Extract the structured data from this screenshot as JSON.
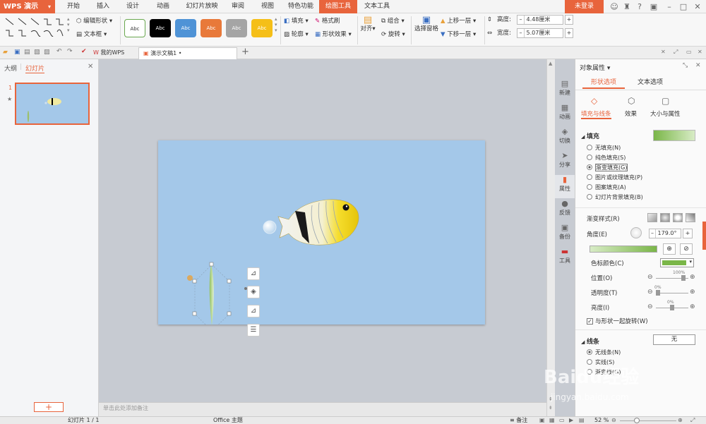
{
  "app": {
    "logo": "WPS 演示"
  },
  "menu": [
    "开始",
    "插入",
    "设计",
    "动画",
    "幻灯片放映",
    "审阅",
    "视图",
    "特色功能",
    "绘图工具",
    "文本工具"
  ],
  "login_label": "未登录",
  "ribbon": {
    "edit_shape": "编辑形状",
    "text_box": "文本框",
    "style_labels": [
      "Abc",
      "Abc",
      "Abc",
      "Abc",
      "Abc",
      "Abc"
    ],
    "fill": "填充",
    "format_brush": "格式刷",
    "outline": "轮廓",
    "shape_effect": "形状效果",
    "align": "对齐",
    "group": "组合",
    "rotate": "旋转",
    "selection_pane": "选择窗格",
    "bring_forward": "上移一层",
    "send_backward": "下移一层",
    "height_label": "高度:",
    "height_value": "4.48厘米",
    "width_label": "宽度:",
    "width_value": "5.07厘米"
  },
  "tabs": {
    "my_wps": "我的WPS",
    "doc": "演示文稿1 •"
  },
  "left_panel": {
    "outline_tab": "大纲",
    "slides_tab": "幻灯片",
    "slide_number": "1"
  },
  "notes_placeholder": "单击此处添加备注",
  "sidebar_items": [
    {
      "icon": "new-icon",
      "glyph": "▤",
      "label": "新建"
    },
    {
      "icon": "animation-icon",
      "glyph": "▦",
      "label": "动画"
    },
    {
      "icon": "switch-icon",
      "glyph": "◈",
      "label": "切换"
    },
    {
      "icon": "share-icon",
      "glyph": "➤",
      "label": "分享"
    },
    {
      "icon": "property-icon",
      "glyph": "▮",
      "label": "属性"
    },
    {
      "icon": "feedback-icon",
      "glyph": "●",
      "label": "反馈"
    },
    {
      "icon": "backup-icon",
      "glyph": "▣",
      "label": "备份"
    },
    {
      "icon": "tools-icon",
      "glyph": "▬",
      "label": "工具"
    }
  ],
  "props": {
    "title": "对象属性 ▾",
    "tab_shape": "形状选项",
    "tab_text": "文本选项",
    "sub_fill": "填充与线条",
    "sub_effect": "效果",
    "sub_size": "大小与属性",
    "fill_section": "填充",
    "fill_options": [
      "无填充(N)",
      "纯色填充(S)",
      "渐变填充(G)",
      "图片或纹理填充(P)",
      "图案填充(A)",
      "幻灯片背景填充(B)"
    ],
    "gradient_style": "渐变样式(R)",
    "angle_label": "角度(E)",
    "angle_value": "179.0°",
    "stop_color": "色标颜色(C)",
    "position": "位置(O)",
    "position_value": "100%",
    "transparency": "透明度(T)",
    "transparency_value": "0%",
    "brightness": "亮度(I)",
    "brightness_value": "0%",
    "rotate_with_shape": "与形状一起旋转(W)",
    "line_section": "线条",
    "line_value": "无",
    "line_options": [
      "无线条(N)",
      "实线(S)",
      "渐变线(G)"
    ]
  },
  "status": {
    "slide_info": "幻灯片 1 / 1",
    "theme": "Office 主题",
    "notes": "备注",
    "zoom": "52 %"
  },
  "colors": {
    "accent": "#e8643c",
    "slide_bg": "#a4c8e9",
    "fill_green": "#7ab648"
  },
  "watermark": {
    "brand": "Baidu经验",
    "url": "jingyan.baidu.com"
  }
}
